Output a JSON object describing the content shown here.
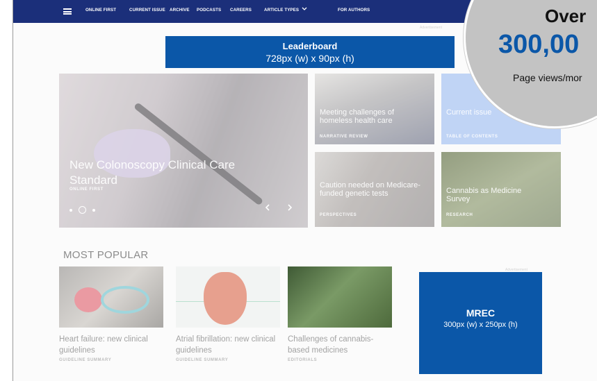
{
  "nav": {
    "menu_icon": "hamburger-menu-icon",
    "items": [
      "ONLINE FIRST",
      "CURRENT ISSUE",
      "ARCHIVE",
      "PODCASTS",
      "CAREERS",
      "ARTICLE TYPES",
      "FOR AUTHORS"
    ],
    "dropdown_icon": "chevron-down-icon",
    "background": "#1b2f7a"
  },
  "ad_label": "Advertisement",
  "leaderboard": {
    "title": "Leaderboard",
    "size": "728px (w) x 90px (h)",
    "color": "#0b57a8"
  },
  "hero": {
    "title": "New Colonoscopy Clinical Care Standard",
    "tag": "ONLINE FIRST",
    "prev_icon": "chevron-left-icon",
    "next_icon": "chevron-right-icon",
    "carousel_dots": 3,
    "active_dot": 2
  },
  "tiles": [
    {
      "title": "Meeting challenges of homeless health care",
      "tag": "NARRATIVE REVIEW"
    },
    {
      "title": "Current issue",
      "tag": "TABLE OF CONTENTS"
    },
    {
      "title": "Caution needed on Medicare-funded genetic tests",
      "tag": "PERSPECTIVES"
    },
    {
      "title": "Cannabis as Medicine Survey",
      "tag": "RESEARCH"
    }
  ],
  "popular": {
    "heading": "MOST POPULAR",
    "items": [
      {
        "title": "Heart failure: new clinical guidelines",
        "tag": "GUIDELINE SUMMARY"
      },
      {
        "title": "Atrial fibrillation: new clinical guidelines",
        "tag": "GUIDELINE SUMMARY"
      },
      {
        "title": "Challenges of cannabis-based medicines",
        "tag": "EDITORIALS"
      }
    ]
  },
  "mrec": {
    "title": "MREC",
    "size": "300px (w) x 250px (h)",
    "color": "#0b57a8"
  },
  "badge": {
    "line1": "Over",
    "line2": "300,00",
    "line3": "Page views/mor"
  }
}
